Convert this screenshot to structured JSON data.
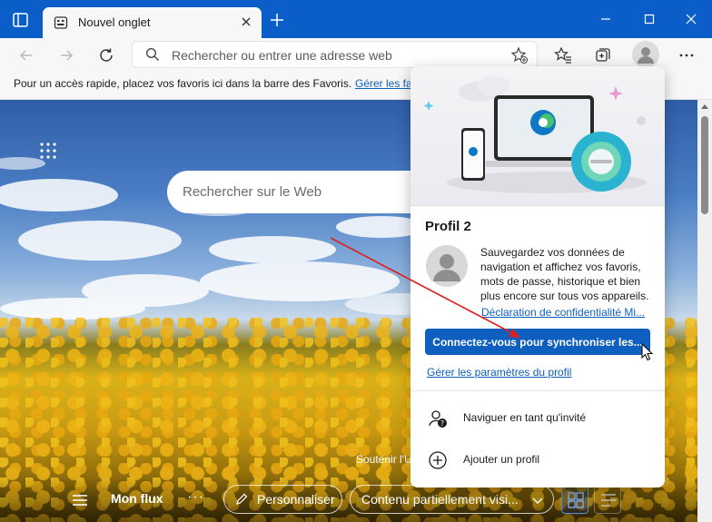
{
  "window": {
    "tab_title": "Nouvel onglet"
  },
  "toolbar": {
    "address_placeholder": "Rechercher ou entrer une adresse web"
  },
  "favorites_bar": {
    "text": "Pour un accès rapide, placez vos favoris ici dans la barre des Favoris.",
    "link": "Gérer les fa"
  },
  "newtab": {
    "search_placeholder": "Rechercher sur le Web",
    "support_text": "Soutenir l'U",
    "feed_label": "Mon flux",
    "more": "···",
    "personalize_label": "Personnaliser",
    "content_select": "Contenu partiellement visi..."
  },
  "profile_flyout": {
    "name": "Profil 2",
    "description": "Sauvegardez vos données de navigation et affichez vos favoris, mots de passe, historique et bien plus encore sur tous vos appareils.",
    "privacy_link": "Déclaration de confidentialité Mi...",
    "signin_button": "Connectez-vous pour synchroniser les...",
    "manage_link": "Gérer les paramètres du profil",
    "menu": [
      {
        "label": "Naviguer en tant qu'invité",
        "icon": "guest-icon"
      },
      {
        "label": "Ajouter un profil",
        "icon": "add-profile-icon"
      }
    ]
  },
  "colors": {
    "titlebar": "#0b5ec7",
    "accent": "#0e5fbf",
    "annotation": "#e0201e"
  }
}
